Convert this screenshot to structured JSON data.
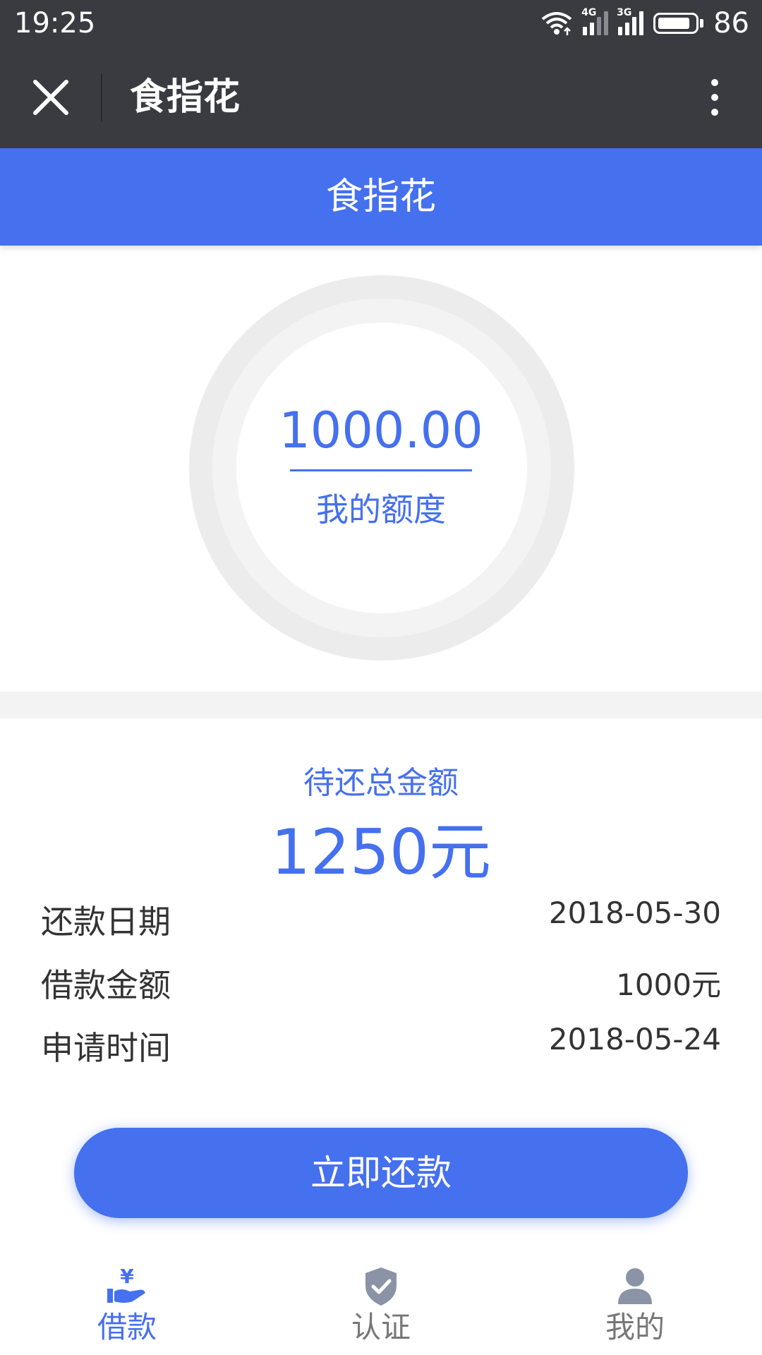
{
  "status_bar": {
    "time": "19:25",
    "net1": "4G",
    "net2": "3G",
    "battery": "86"
  },
  "navbar": {
    "title": "食指花"
  },
  "header": {
    "title": "食指花"
  },
  "credit": {
    "amount": "1000.00",
    "label": "我的额度"
  },
  "repayment": {
    "pending_label": "待还总金额",
    "pending_amount": "1250元",
    "rows": [
      {
        "label": "还款日期",
        "value": "2018-05-30"
      },
      {
        "label": "借款金额",
        "value": "1000元"
      },
      {
        "label": "申请时间",
        "value": "2018-05-24"
      }
    ]
  },
  "pay_button": {
    "label": "立即还款"
  },
  "tabs": [
    {
      "label": "借款",
      "icon": "loan-icon",
      "active": true
    },
    {
      "label": "认证",
      "icon": "shield-check-icon",
      "active": false
    },
    {
      "label": "我的",
      "icon": "user-icon",
      "active": false
    }
  ],
  "colors": {
    "accent": "#4570ee",
    "topbar": "#3a3b40",
    "inactive": "#777777"
  }
}
